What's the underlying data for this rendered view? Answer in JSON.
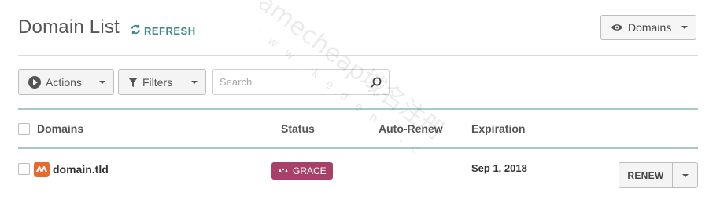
{
  "header": {
    "title": "Domain List",
    "refresh_label": "REFRESH",
    "domains_dropdown_label": "Domains"
  },
  "toolbar": {
    "actions_label": "Actions",
    "filters_label": "Filters",
    "search_placeholder": "Search"
  },
  "table": {
    "columns": [
      "Domains",
      "Status",
      "Auto-Renew",
      "Expiration"
    ],
    "rows": [
      {
        "domain": "domain.tld",
        "status": "GRACE",
        "auto_renew": "",
        "expiration": "Sep 1, 2018",
        "action_label": "RENEW"
      }
    ]
  },
  "watermark": {
    "line1": "namecheap域名注册",
    "line2": "www.kedeng.c"
  },
  "colors": {
    "accent_teal": "#3c8a83",
    "grace_badge": "#a84069",
    "domain_icon": "#e8692f"
  },
  "icons": {
    "refresh": "refresh-icon",
    "domains_dropdown": "eye-icon",
    "actions": "play-circle-icon",
    "filters": "funnel-icon",
    "search": "magnifier-icon",
    "status": "grace-bells-icon",
    "domain": "namecheap-logo-icon"
  }
}
